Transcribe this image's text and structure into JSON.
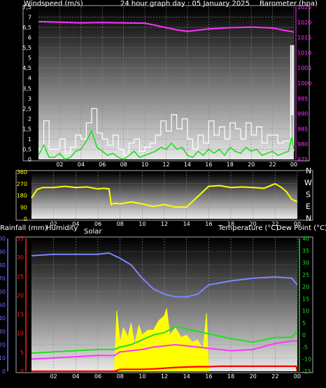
{
  "titles": {
    "windspeed_label": "Windspeed (m/s)",
    "graph_title": "24 hour graph day : 05 January 2025",
    "barometer_label": "Barometer (hpa)",
    "rainfall_label": "Rainfall (mm)",
    "humidity_label": "Humidity",
    "solar_label": "Solar",
    "temperature_label": "Temperature (°C)",
    "dewpoint_label": "Dew Point (°C)"
  },
  "colors": {
    "barometer": "#ff33ff",
    "wind_gust": "#ffffff",
    "wind_avg": "#22dd22",
    "wind_dir": "#ffff00",
    "humidity": "#7f86ff",
    "temperature": "#22dd22",
    "dewpoint": "#ff33ff",
    "solar": "#ffff00",
    "rainfall": "#ff0000",
    "rain_axis": "#ff2020",
    "humidity_axis": "#6a6aff",
    "temp_axis": "#22dd22"
  },
  "compass": [
    "N",
    "W",
    "S",
    "E",
    "N"
  ],
  "chart_data": [
    {
      "type": "line",
      "title": "24 hour graph day : 05 January 2025",
      "ylabel": "Windspeed (m/s)",
      "y2label": "Barometer (hpa)",
      "x_ticks": [
        "02",
        "04",
        "06",
        "08",
        "10",
        "12",
        "14",
        "16",
        "18",
        "20",
        "22",
        "00"
      ],
      "y_ticks": [
        "0",
        "0,5",
        "1",
        "1,5",
        "2",
        "2,5",
        "3",
        "3,5",
        "4",
        "4,5",
        "5",
        "5,5",
        "6",
        "6,5",
        "7",
        "7,5"
      ],
      "y2_ticks": [
        "975",
        "980",
        "985",
        "990",
        "995",
        "1000",
        "1005",
        "1010",
        "1015",
        "1020",
        "1025"
      ],
      "ylim": [
        0,
        7.5
      ],
      "y2lim": [
        975,
        1025
      ],
      "series": [
        {
          "name": "Barometer",
          "axis": "right",
          "x": [
            0,
            2,
            4,
            6,
            8,
            10,
            11,
            12,
            13,
            14,
            15,
            16,
            18,
            20,
            22,
            24
          ],
          "values": [
            1020.2,
            1020.0,
            1019.8,
            1019.9,
            1019.8,
            1019.7,
            1019.0,
            1018.2,
            1017.5,
            1017.0,
            1017.4,
            1017.8,
            1018.2,
            1018.4,
            1018.1,
            1016.8
          ]
        },
        {
          "name": "Wind gust",
          "axis": "left",
          "x": [
            0,
            0.5,
            1,
            1.5,
            2,
            2.5,
            3,
            3.5,
            4,
            4.5,
            5,
            5.5,
            6,
            6.5,
            7,
            7.5,
            8,
            8.5,
            9,
            9.5,
            10,
            10.5,
            11,
            11.5,
            12,
            12.5,
            13,
            13.5,
            14,
            14.5,
            15,
            15.5,
            16,
            16.5,
            17,
            17.5,
            18,
            18.5,
            19,
            19.5,
            20,
            20.5,
            21,
            21.5,
            22,
            22.5,
            23,
            23.5,
            23.7,
            23.8,
            23.9,
            24
          ],
          "values": [
            0.5,
            1.9,
            0.5,
            0.5,
            1.0,
            0.3,
            0.6,
            1.2,
            1.0,
            1.8,
            2.5,
            1.3,
            1.0,
            0.7,
            1.2,
            0.5,
            0.2,
            0.8,
            1.0,
            0.4,
            0.6,
            0.8,
            1.2,
            1.9,
            1.4,
            2.2,
            1.5,
            2.0,
            1.0,
            0.5,
            1.2,
            0.8,
            1.9,
            1.2,
            1.6,
            1.0,
            1.8,
            1.5,
            1.0,
            1.8,
            1.2,
            1.6,
            0.8,
            1.2,
            1.2,
            0.8,
            0.9,
            0.9,
            5.6,
            2.2,
            5.6,
            0.4
          ]
        },
        {
          "name": "Wind average",
          "axis": "left",
          "x": [
            0,
            0.5,
            1,
            1.5,
            2,
            2.5,
            3,
            3.5,
            4,
            4.5,
            5,
            5.5,
            6,
            6.5,
            7,
            7.5,
            8,
            8.5,
            9,
            9.5,
            10,
            10.5,
            11,
            11.5,
            12,
            12.5,
            13,
            13.5,
            14,
            14.5,
            15,
            15.5,
            16,
            16.5,
            17,
            17.5,
            18,
            18.5,
            19,
            19.5,
            20,
            20.5,
            21,
            21.5,
            22,
            22.5,
            23,
            23.5,
            23.8,
            24
          ],
          "values": [
            0.2,
            0.7,
            0.1,
            0.1,
            0.3,
            0.0,
            0.1,
            0.4,
            0.5,
            0.9,
            1.4,
            0.6,
            0.4,
            0.2,
            0.3,
            0.1,
            0.0,
            0.2,
            0.4,
            0.1,
            0.2,
            0.3,
            0.4,
            0.6,
            0.5,
            0.8,
            0.5,
            0.6,
            0.2,
            0.1,
            0.4,
            0.2,
            0.5,
            0.3,
            0.5,
            0.2,
            0.6,
            0.4,
            0.3,
            0.6,
            0.4,
            0.5,
            0.2,
            0.3,
            0.4,
            0.2,
            0.3,
            0.4,
            1.1,
            0.5
          ]
        }
      ]
    },
    {
      "type": "line",
      "ylabel": "",
      "x_ticks": [
        "02",
        "04",
        "06",
        "08",
        "10",
        "12",
        "14",
        "16",
        "18",
        "20",
        "22",
        "00"
      ],
      "y_ticks": [
        "0",
        "90",
        "180",
        "270",
        "360"
      ],
      "ylim": [
        0,
        360
      ],
      "series": [
        {
          "name": "Wind direction",
          "x": [
            0,
            0.5,
            1,
            2,
            3,
            4,
            5,
            6,
            6.5,
            7,
            7.2,
            7.5,
            8,
            9,
            10,
            11,
            12,
            13,
            14,
            14.5,
            15,
            16,
            17,
            18,
            19,
            20,
            21,
            22,
            22.5,
            23,
            23.5,
            24
          ],
          "values": [
            160,
            225,
            240,
            240,
            250,
            240,
            245,
            230,
            235,
            230,
            110,
            120,
            115,
            130,
            115,
            95,
            110,
            90,
            90,
            130,
            170,
            250,
            255,
            240,
            245,
            240,
            235,
            270,
            245,
            210,
            150,
            130
          ]
        }
      ]
    },
    {
      "type": "line",
      "x_ticks": [
        "02",
        "04",
        "06",
        "08",
        "10",
        "12",
        "14",
        "16",
        "18",
        "20",
        "22",
        "00"
      ],
      "rain_ticks": [
        "0",
        "5",
        "10",
        "15",
        "20",
        "25",
        "30",
        "35"
      ],
      "humidity_ticks": [
        "0",
        "10",
        "20",
        "30",
        "40",
        "50",
        "60",
        "70",
        "80",
        "90",
        "100"
      ],
      "temp_ticks": [
        "-15",
        "-10",
        "-5",
        "0",
        "5",
        "10",
        "15",
        "20",
        "25",
        "30",
        "35",
        "40"
      ],
      "rain_lim": [
        0,
        35
      ],
      "humidity_lim": [
        0,
        100
      ],
      "temp_lim": [
        -15,
        40
      ],
      "series": [
        {
          "name": "Humidity",
          "axis": "humidity",
          "x": [
            0,
            2,
            4,
            6,
            7,
            8,
            9,
            10,
            11,
            12,
            13,
            14,
            15,
            16,
            18,
            20,
            22,
            23.5,
            24
          ],
          "values": [
            87,
            88,
            88,
            88,
            89,
            85,
            80,
            70,
            62,
            58,
            56,
            56,
            58,
            65,
            68,
            70,
            71,
            70,
            65
          ]
        },
        {
          "name": "Temperature",
          "axis": "temp",
          "x": [
            0,
            2,
            4,
            6,
            7.5,
            8,
            9,
            10,
            11,
            12,
            13,
            14,
            15,
            16,
            18,
            20,
            22,
            23.5,
            24
          ],
          "values": [
            -7.5,
            -7.0,
            -6.5,
            -6.0,
            -6.0,
            -5.0,
            -4.0,
            -2.0,
            0.0,
            1.0,
            3.5,
            2.5,
            1.5,
            0.5,
            -1.5,
            -3.0,
            -1.0,
            -1.0,
            1.5
          ]
        },
        {
          "name": "Dew Point",
          "axis": "temp",
          "x": [
            0,
            2,
            4,
            6,
            7.5,
            8,
            9,
            10,
            11,
            12,
            13,
            14,
            15,
            16,
            18,
            20,
            22,
            23.5,
            24
          ],
          "values": [
            -10,
            -9.5,
            -9,
            -8.5,
            -8.5,
            -7,
            -6.5,
            -6,
            -5,
            -4.5,
            -4,
            -4.5,
            -5,
            -5.5,
            -6.5,
            -6,
            -3.5,
            -2.5,
            -2.5
          ]
        },
        {
          "name": "Solar",
          "axis": "temp",
          "x": [
            7.5,
            7.7,
            8,
            8.3,
            8.7,
            9,
            9.3,
            9.7,
            10,
            10.5,
            11,
            11.5,
            12,
            12.2,
            12.5,
            13,
            13.5,
            14,
            14.5,
            15,
            15.5,
            15.8,
            16
          ],
          "values": [
            -13,
            10,
            -3,
            3,
            -1,
            5,
            -4,
            4,
            0,
            2,
            2,
            6,
            8,
            11,
            0,
            3,
            -1,
            0,
            -3,
            -2,
            -6,
            9,
            -13
          ]
        },
        {
          "name": "Rainfall",
          "axis": "rain",
          "x": [
            0,
            7.5,
            8,
            9,
            10,
            11,
            12,
            13,
            14,
            15,
            15.9,
            16,
            17,
            18,
            20,
            22,
            23.9,
            24
          ],
          "values": [
            0,
            0,
            0.5,
            0.5,
            0.5,
            0.6,
            0.8,
            1.0,
            1.1,
            1.2,
            1.2,
            1.2,
            1.3,
            1.3,
            1.3,
            1.3,
            1.3,
            0
          ]
        }
      ]
    }
  ]
}
